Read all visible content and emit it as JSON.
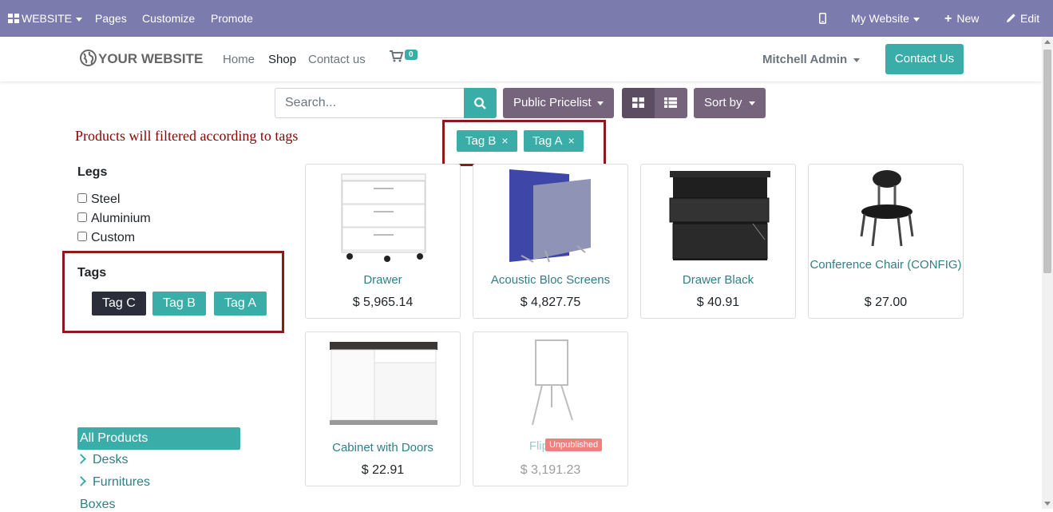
{
  "topbar": {
    "website_menu": "WEBSITE",
    "pages": "Pages",
    "customize": "Customize",
    "promote": "Promote",
    "site_selector": "My Website",
    "new_label": "New",
    "edit_label": "Edit"
  },
  "header": {
    "logo": "YOUR WEBSITE",
    "nav": {
      "home": "Home",
      "shop": "Shop",
      "contact": "Contact us"
    },
    "cart_count": "0",
    "user": "Mitchell Admin",
    "contact_button": "Contact Us"
  },
  "toolbar": {
    "search_placeholder": "Search...",
    "pricelist": "Public Pricelist",
    "sort_by": "Sort by"
  },
  "annotation": "Products will filtered according to tags",
  "active_tags": [
    {
      "label": "Tag B",
      "remove": "×"
    },
    {
      "label": "Tag A",
      "remove": "×"
    }
  ],
  "sidebar": {
    "legs_title": "Legs",
    "legs": [
      "Steel",
      "Aluminium",
      "Custom"
    ],
    "tags_title": "Tags",
    "tags": [
      {
        "label": "Tag C",
        "color": "#2b2d3a"
      },
      {
        "label": "Tag B",
        "color": "#3aada8"
      },
      {
        "label": "Tag A",
        "color": "#3aada8"
      }
    ],
    "categories": [
      "All Products",
      "Desks",
      "Furnitures",
      "Boxes"
    ]
  },
  "products": [
    {
      "name": "Drawer",
      "price": "$ 5,965.14"
    },
    {
      "name": "Acoustic Bloc Screens",
      "price": "$ 4,827.75"
    },
    {
      "name": "Drawer Black",
      "price": "$ 40.91"
    },
    {
      "name": "Conference Chair (CONFIG)",
      "price": "$ 27.00"
    },
    {
      "name": "Cabinet with Doors",
      "price": "$ 22.91"
    },
    {
      "name": "Flipover",
      "price": "$ 3,191.23",
      "badge": "Unpublished"
    }
  ],
  "colors": {
    "navbar": "#7c7bad",
    "teal": "#3aada8",
    "annotation_red": "#8b1a1a",
    "button_mauve": "#75647c"
  }
}
